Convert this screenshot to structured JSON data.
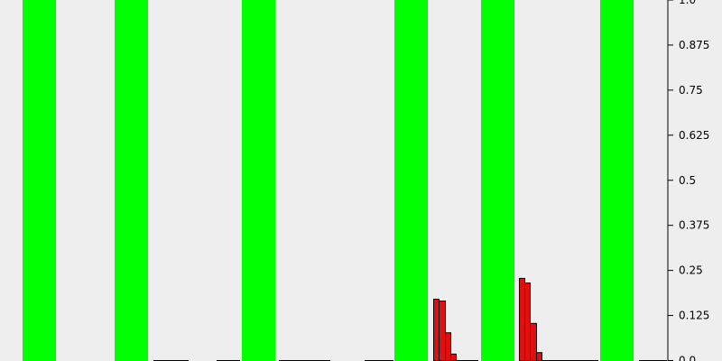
{
  "chart_data": {
    "type": "bar",
    "ylim": [
      0,
      1
    ],
    "y_axis_position": "right",
    "y_ticks": [
      {
        "value": 1.0,
        "label": "1.0"
      },
      {
        "value": 0.875,
        "label": "0.875"
      },
      {
        "value": 0.75,
        "label": "0.75"
      },
      {
        "value": 0.625,
        "label": "0.625"
      },
      {
        "value": 0.5,
        "label": "0.5"
      },
      {
        "value": 0.375,
        "label": "0.375"
      },
      {
        "value": 0.25,
        "label": "0.25"
      },
      {
        "value": 0.125,
        "label": "0.125"
      },
      {
        "value": 0.0,
        "label": "0.0"
      }
    ],
    "x_range": [
      0,
      740
    ],
    "highlight_bands": {
      "color": "#00ff00",
      "spans": [
        [
          25,
          62
        ],
        [
          127,
          164
        ],
        [
          268,
          305
        ],
        [
          437,
          474
        ],
        [
          533,
          570
        ],
        [
          665,
          702
        ]
      ],
      "value": 1.0
    },
    "bars": {
      "color": "#e01010",
      "outline": "#000000",
      "items": [
        {
          "x": [
            480,
            486
          ],
          "value": 0.17
        },
        {
          "x": [
            486,
            493
          ],
          "value": 0.165
        },
        {
          "x": [
            493,
            499
          ],
          "value": 0.077
        },
        {
          "x": [
            499,
            505
          ],
          "value": 0.018
        },
        {
          "x": [
            575,
            581
          ],
          "value": 0.228
        },
        {
          "x": [
            581,
            587
          ],
          "value": 0.215
        },
        {
          "x": [
            587,
            594
          ],
          "value": 0.103
        },
        {
          "x": [
            594,
            600
          ],
          "value": 0.022
        }
      ]
    },
    "baseline_segments": [
      [
        170,
        209
      ],
      [
        240,
        266
      ],
      [
        309,
        366
      ],
      [
        404,
        436
      ],
      [
        505,
        530
      ],
      [
        600,
        663
      ],
      [
        708,
        739
      ]
    ]
  }
}
